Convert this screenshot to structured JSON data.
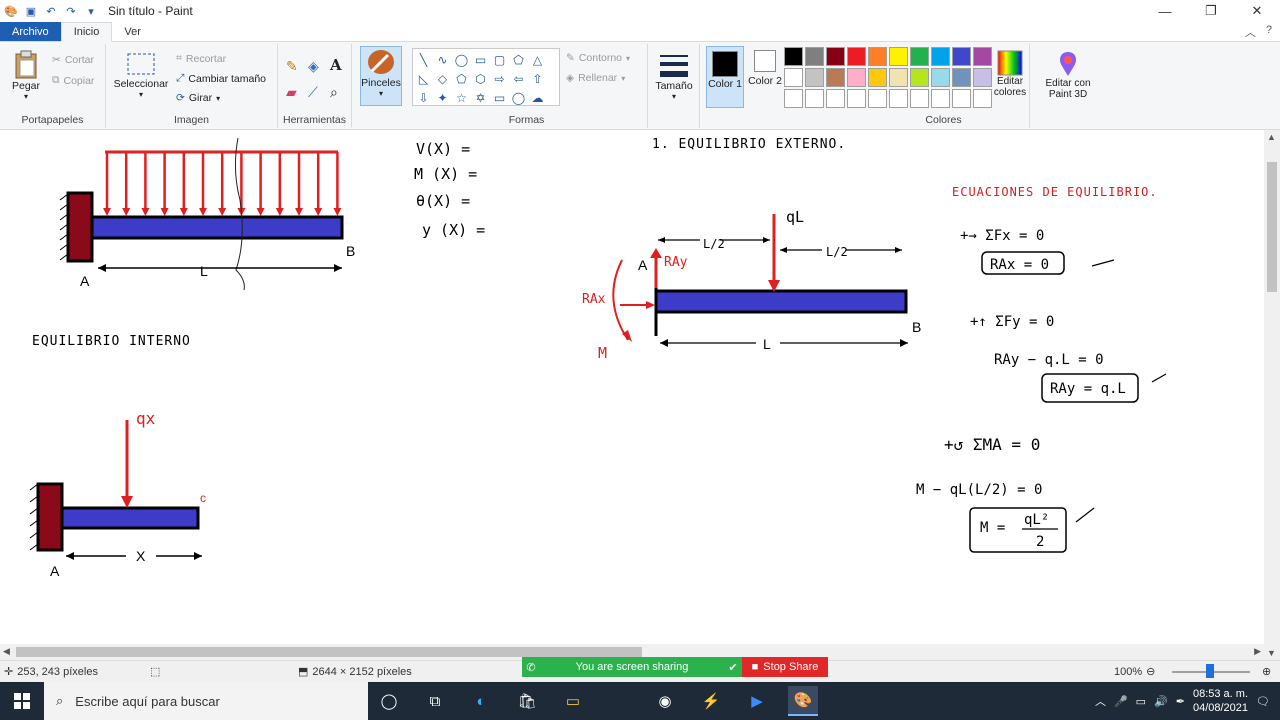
{
  "window": {
    "title": "Sin título - Paint"
  },
  "tabs": [
    {
      "label": "Archivo"
    },
    {
      "label": "Inicio"
    },
    {
      "label": "Ver"
    }
  ],
  "ribbon": {
    "clipboard": {
      "paste": "Pegar",
      "cut": "Cortar",
      "copy": "Copiar",
      "label": "Portapapeles"
    },
    "image": {
      "select": "Seleccionar",
      "crop": "Recortar",
      "resize": "Cambiar tamaño",
      "rotate": "Girar",
      "label": "Imagen"
    },
    "tools": {
      "label": "Herramientas"
    },
    "brushes": {
      "label": "Pinceles"
    },
    "shapes": {
      "outline": "Contorno",
      "fill": "Rellenar",
      "label": "Formas"
    },
    "size": {
      "label": "Tamaño"
    },
    "colors": {
      "color1": "Color 1",
      "color2": "Color 2",
      "edit": "Editar colores",
      "label": "Colores",
      "color1_value": "#000000",
      "color2_value": "#ffffff",
      "palette": [
        "#000000",
        "#7f7f7f",
        "#880015",
        "#ed1c24",
        "#ff7f27",
        "#fff200",
        "#22b14c",
        "#00a2e8",
        "#3f48cc",
        "#a349a4",
        "#ffffff",
        "#c3c3c3",
        "#b97a57",
        "#ffaec9",
        "#ffc90e",
        "#efe4b0",
        "#b5e61d",
        "#99d9ea",
        "#7092be",
        "#c8bfe7",
        "#ffffff",
        "#ffffff",
        "#ffffff",
        "#ffffff",
        "#ffffff",
        "#ffffff",
        "#ffffff",
        "#ffffff",
        "#ffffff",
        "#ffffff"
      ]
    },
    "paint3d": "Editar con Paint 3D"
  },
  "canvas": {
    "top_left": {
      "label_a": "A",
      "label_b": "B",
      "label_l": "L"
    },
    "internal_title": "EQUILIBRIO INTERNO",
    "bottom_left": {
      "label_a": "A",
      "label_c": "c",
      "label_x": "X",
      "load": "qx"
    },
    "functions": [
      "V(X) =",
      "M (X) =",
      "θ(X) =",
      "y (X) ="
    ],
    "external_title": "1.  EQUILIBRIO  EXTERNO.",
    "middle": {
      "label_a": "A",
      "label_b": "B",
      "rax": "RAx",
      "ray": "RAy",
      "m": "M",
      "load": "qL",
      "half1": "L/2",
      "half2": "L/2",
      "length": "L"
    },
    "eq_title": "ECUACIONES DE EQUILIBRIO.",
    "eq1": "+→ ΣFx = 0",
    "eq1_box": "RAx = 0",
    "eq2": "+↑ ΣFy = 0",
    "eq2_line": "RAy − q.L = 0",
    "eq2_box": "RAy = q.L",
    "eq3": "+↺ ΣMA = 0",
    "eq3_line": "M − qL(L/2) = 0",
    "eq3_box_num": "qL²",
    "eq3_box_left": "M =",
    "eq3_box_den": "2"
  },
  "status": {
    "cursor": "253, 243 píxeles",
    "size": "2644 × 2152 píxeles",
    "zoom": "100%",
    "sharing": "You are screen sharing",
    "stop": "Stop Share"
  },
  "taskbar": {
    "search_placeholder": "Escribe aquí para buscar",
    "time": "08:53 a. m.",
    "date": "04/08/2021"
  }
}
